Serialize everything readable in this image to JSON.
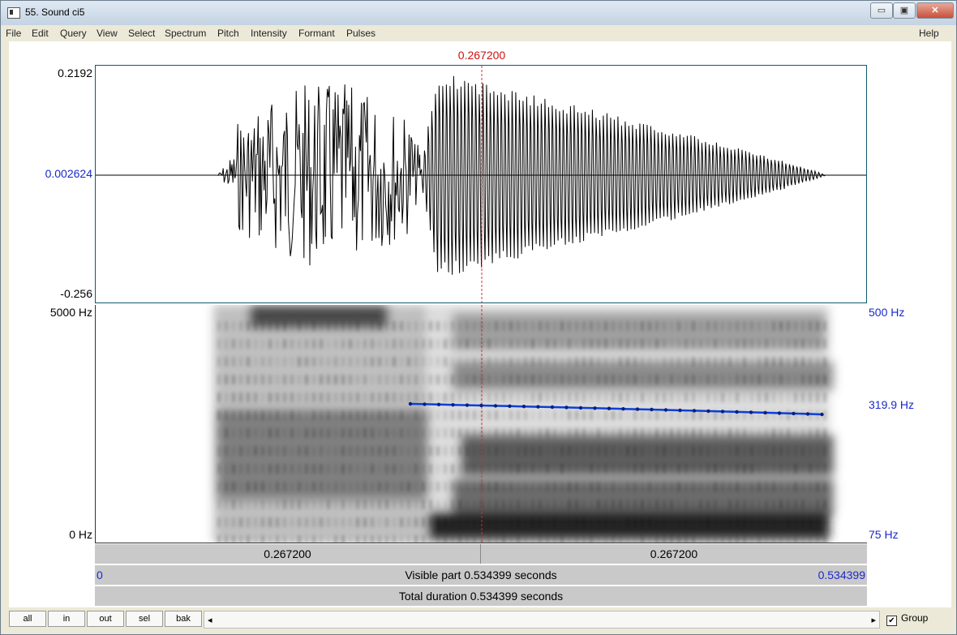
{
  "window": {
    "title": "55. Sound ci5",
    "controls": [
      "▭",
      "▣",
      "✕"
    ]
  },
  "menu": {
    "items": [
      "File",
      "Edit",
      "Query",
      "View",
      "Select",
      "Spectrum",
      "Pitch",
      "Intensity",
      "Formant",
      "Pulses"
    ],
    "help": "Help"
  },
  "cursor": {
    "time_label": "0.267200"
  },
  "waveform": {
    "y_max": "0.2192",
    "y_cursor": "0.002624",
    "y_min": "-0.256"
  },
  "spectrogram": {
    "freq_max": "5000 Hz",
    "freq_min": "0 Hz",
    "pitch_max": "500 Hz",
    "pitch_value": "319.9 Hz",
    "pitch_min": "75 Hz",
    "colors": {
      "pitch": "#0b3fd8"
    }
  },
  "time_bars": {
    "left_interval": "0.267200",
    "right_interval": "0.267200",
    "visible_start": "0",
    "visible_text": "Visible part 0.534399 seconds",
    "visible_end": "0.534399",
    "total_text": "Total duration 0.534399 seconds"
  },
  "bottom": {
    "buttons": [
      "all",
      "in",
      "out",
      "sel",
      "bak"
    ],
    "group_label": "Group",
    "group_checked": "✔",
    "scroll_left": "◂",
    "scroll_right": "▸"
  }
}
